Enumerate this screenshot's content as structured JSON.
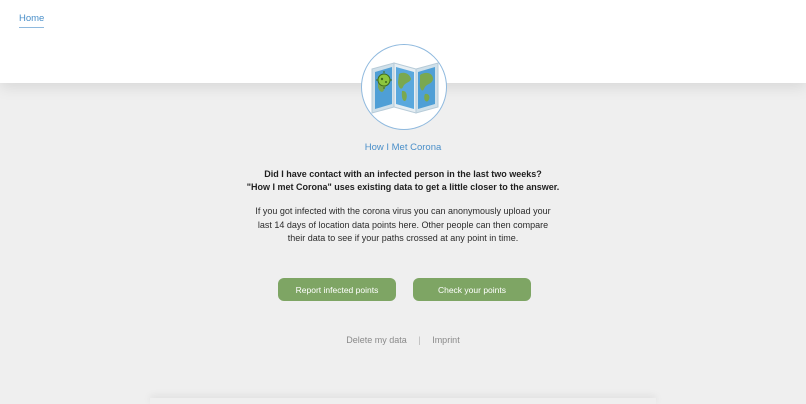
{
  "nav": {
    "home_label": "Home"
  },
  "app": {
    "title": "How I Met Corona"
  },
  "intro": {
    "question": "Did I have contact with an infected person in the last two weeks?",
    "subtitle": "\"How I met Corona\" uses existing data to get a little closer to the answer.",
    "description": "If you got infected with the corona virus you can anonymously upload your last 14 days of location data points here. Other people can then compare their data to see if your paths crossed at any point in time."
  },
  "actions": {
    "report_label": "Report infected points",
    "check_label": "Check your points"
  },
  "footer": {
    "delete_label": "Delete my data",
    "separator": "|",
    "imprint_label": "Imprint"
  },
  "colors": {
    "accent_blue": "#4a8fc9",
    "button_green": "#7ea564",
    "background": "#efefef"
  },
  "icons": {
    "logo": "world-map-virus-icon"
  }
}
